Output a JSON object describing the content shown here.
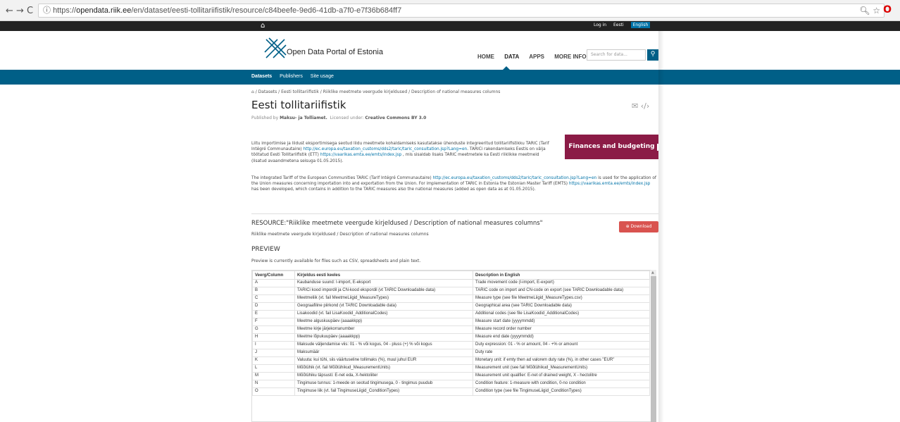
{
  "browser": {
    "url_prefix": "https://",
    "url_domain": "opendata.riik.ee",
    "url_path": "/en/dataset/eesti-tollitariifistik/resource/c84beefe-9ed6-41db-a7f0-e7f36b684ff7"
  },
  "topbar": {
    "login": "Log in",
    "lang_et": "Eesti",
    "lang_en": "English"
  },
  "header": {
    "logo_text": "Open Data Portal of Estonia",
    "menu": [
      "HOME",
      "DATA",
      "APPS",
      "MORE INFO"
    ],
    "search_placeholder": "Search for data..."
  },
  "subnav": [
    "Datasets",
    "Publishers",
    "Site usage"
  ],
  "breadcrumb": "Datasets  /  Eesti tollitariifistik  /  Riiklike meetmete veergude kirjeldused / Description of national measures columns",
  "title": "Eesti tollitariifistik",
  "published_label": "Published by",
  "publisher": "Maksu- ja Tolliamet.",
  "license_label": "Licensed under:",
  "license": "Creative Commons BY 3.0",
  "desc_et_1": "Liitu importimise ja liidust eksportimisega seotud liidu meetmete kohaldamiseks kasutatakse ühenduste integreeritud tollitariifistikku TARIC (Tarif Intégré Communautaire)",
  "desc_et_link1": "http://ec.europa.eu/taxation_customs/dds2/taric/taric_consultation.jsp?Lang=en",
  "desc_et_2": ". TARICi rakendamiseks Eestis on välja töötatud Eesti Tollitariifistik (ETT)",
  "desc_et_link2": "https://vaarikas.emta.ee/emts/index.jsp",
  "desc_et_3": ", mis sisaldab lisaks TARIC meetmetele ka Eesti riiklikke meetmeid (lisatud avaandmetena seisuga 01.05.2015).",
  "desc_en_1": "The integrated Tariff of the European Communities TARIC (Tarif Intégré Communautaire)",
  "desc_en_link1": "http://ec.europa.eu/taxation_customs/dds2/taric/taric_consultation.jsp?Lang=en",
  "desc_en_2": "is used for the application of the Union measures concerning importation into and exportation from the Union. For implementation of TARIC in Estonia the Estonian Master Tariff (EMTS)",
  "desc_en_link2": "https://vaarikas.emta.ee/emts/index.jsp",
  "desc_en_3": "has been developed, which contains in addition to the TARIC measures also the national measures (added as open data as at 01.05.2015).",
  "category": "Finances and budgeting",
  "resource_title": "RESOURCE:\"Riiklike meetmete veergude kirjeldused / Description of national measures columns\"",
  "resource_sub": "Riiklike meetmete veergude kirjeldused / Description of national measures columns",
  "download": "Download",
  "preview_heading": "PREVIEW",
  "preview_note": "Preview is currently available for files such as CSV, spreadsheets and plain text.",
  "table": {
    "headers": [
      "Veerg/Column",
      "Kirjeldus eesti keeles",
      "Description in English"
    ],
    "rows": [
      [
        "A",
        "Kaubanduse suund: I-import, E-eksport",
        "Trade movement code (I-import, E-export)"
      ],
      [
        "B",
        "TARICi kood impordil ja CN-kood ekspordil (vt TARIC Downloadable data)",
        "TARIC code on import and CN-code on export (see TARIC Downloadable data)"
      ],
      [
        "C",
        "Meetmeliik (vt. fail MeetmeLiigid_MeasureTypes)",
        "Measure type (see file MeetmeLiigid_MeasureTypes.csv)"
      ],
      [
        "D",
        "Geograafiline piirkond (vt TARIC Downloadable data)",
        "Geographical area (see TARIC Downloadable data)"
      ],
      [
        "E",
        "Lisakoodid (vt. fail LisaKoodid_AdditionalCodes)",
        "Additional codes (see file LisaKoodid_AdditionalCodes)"
      ],
      [
        "F",
        "Meetme alguskuupäev (aaaakkpp)",
        "Measure start date (yyyymmdd)"
      ],
      [
        "G",
        "Meetme kirje järjekorranumber",
        "Measure record order number"
      ],
      [
        "H",
        "Meetme lõpukuupäev (aaaakkpp)",
        "Measure end date (yyyymmdd)"
      ],
      [
        "I",
        "Maksude väljendamise viis: 01 - % või kogus, 04 - pluss (+) % või kogus",
        "Duty expression: 01 - % or amount, 04 - +% or amount"
      ],
      [
        "J",
        "Maksumäär",
        "Duty rate"
      ],
      [
        "K",
        "Valuuta: kui tühi, siis väärtuseline tollimaks (%), muul juhul EUR",
        "Monetary unit: if emty then ad valorem duty rate (%), in other cases \"EUR\""
      ],
      [
        "L",
        "Mõõtühik (vt. fail Mõõtühikud_MeasurementUnits)",
        "Measurement unit (see fail Mõõtühikud_MeasurementUnits)"
      ],
      [
        "M",
        "Mõõtühiku täpsusti: E-net eda, X-hektoliiter",
        "Measurement unit qualifier: E-net of drained weight, X - hectolitre"
      ],
      [
        "N",
        "Tingimuse tunnus: 1-meede on seotud tingimusega, 0 - tingimus puudub",
        "Condition feature: 1-measure with condition, 0-no condition"
      ],
      [
        "O",
        "Tingimuse liik (vt. fail TingimuseLiigid_ConditionTypes)",
        "Condition type (see file TingimuseLiigid_ConditionTypes)"
      ]
    ]
  }
}
